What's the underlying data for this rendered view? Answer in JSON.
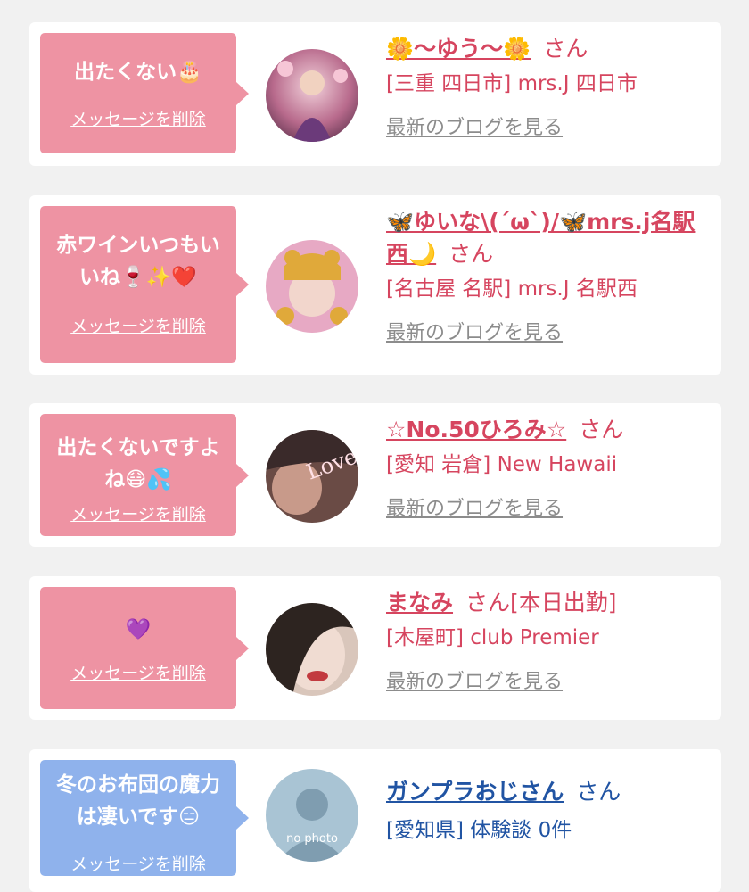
{
  "cards": [
    {
      "message": "出たくない🎂",
      "delete_label": "メッセージを削除",
      "name": "🌼〜ゆう〜🌼",
      "honorific": "さん",
      "location": "[三重 四日市] mrs.J 四日市",
      "blog_link": "最新のブログを見る"
    },
    {
      "message": "赤ワインいつもいいね🍷✨❤️",
      "delete_label": "メッセージを削除",
      "name": "🦋ゆいな\\(´ω`)/🦋mrs.j名駅西🌙",
      "honorific": "さん",
      "location": "[名古屋 名駅] mrs.J 名駅西",
      "blog_link": "最新のブログを見る"
    },
    {
      "message": "出たくないですよね😷💦",
      "delete_label": "メッセージを削除",
      "name": "☆No.50ひろみ☆",
      "honorific": "さん",
      "location": "[愛知 岩倉] New Hawaii",
      "blog_link": "最新のブログを見る",
      "avatar_text": "Love"
    },
    {
      "message": "💜",
      "delete_label": "メッセージを削除",
      "name": "まなみ",
      "honorific": "さん[本日出勤]",
      "location": "[木屋町] club Premier",
      "blog_link": "最新のブログを見る"
    },
    {
      "message": "冬のお布団の魔力は凄いです😑",
      "delete_label": "メッセージを削除",
      "name": "ガンプラおじさん",
      "honorific": "さん",
      "location": "[愛知県] 体験談 0件",
      "avatar_text": "no photo"
    }
  ],
  "colors": {
    "pink_bubble": "#ee93a3",
    "blue_bubble": "#8fb2ec",
    "pink_link": "#d6455f",
    "blue_link": "#2154a3",
    "gray_link": "#8c8c8c",
    "background": "#f1f1f1"
  }
}
